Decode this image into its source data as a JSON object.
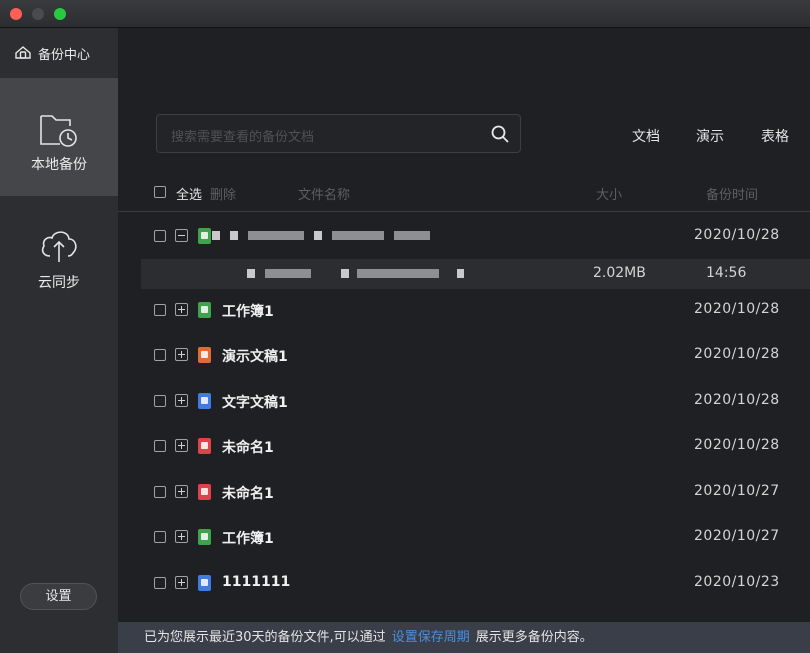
{
  "window": {
    "traffic_lights": [
      "close",
      "minimize",
      "maximize"
    ]
  },
  "sidebar": {
    "brand": "备份中心",
    "items": [
      {
        "label": "本地备份",
        "icon": "folder-clock-icon",
        "active": true
      },
      {
        "label": "云同步",
        "icon": "cloud-upload-icon",
        "active": false
      }
    ],
    "settings_label": "设置"
  },
  "search": {
    "placeholder": "搜索需要查看的备份文档",
    "icon": "search-icon"
  },
  "filters": [
    "文档",
    "演示",
    "表格"
  ],
  "table": {
    "headers": {
      "select_all": "全选",
      "delete": "删除",
      "name": "文件名称",
      "size": "大小",
      "time": "备份时间"
    },
    "rows": [
      {
        "name": "",
        "date": "2020/10/28",
        "type": "sheet",
        "expanded": true
      },
      {
        "name": "工作簿1",
        "date": "2020/10/28",
        "type": "sheet"
      },
      {
        "name": "演示文稿1",
        "date": "2020/10/28",
        "type": "ppt"
      },
      {
        "name": "文字文稿1",
        "date": "2020/10/28",
        "type": "doc"
      },
      {
        "name": "未命名1",
        "date": "2020/10/28",
        "type": "pdf"
      },
      {
        "name": "未命名1",
        "date": "2020/10/27",
        "type": "pdf"
      },
      {
        "name": "工作簿1",
        "date": "2020/10/27",
        "type": "sheet"
      },
      {
        "name": "1111111",
        "date": "2020/10/23",
        "type": "doc"
      }
    ],
    "subrow": {
      "size": "2.02MB",
      "time": "14:56"
    }
  },
  "footer": {
    "text_before": "已为您展示最近30天的备份文件,可以通过",
    "link": "设置保存周期",
    "text_after": "展示更多备份内容。"
  },
  "colors": {
    "accent": "#4a90e2",
    "sidebar_active": "#44464a",
    "background": "#1f2023"
  }
}
